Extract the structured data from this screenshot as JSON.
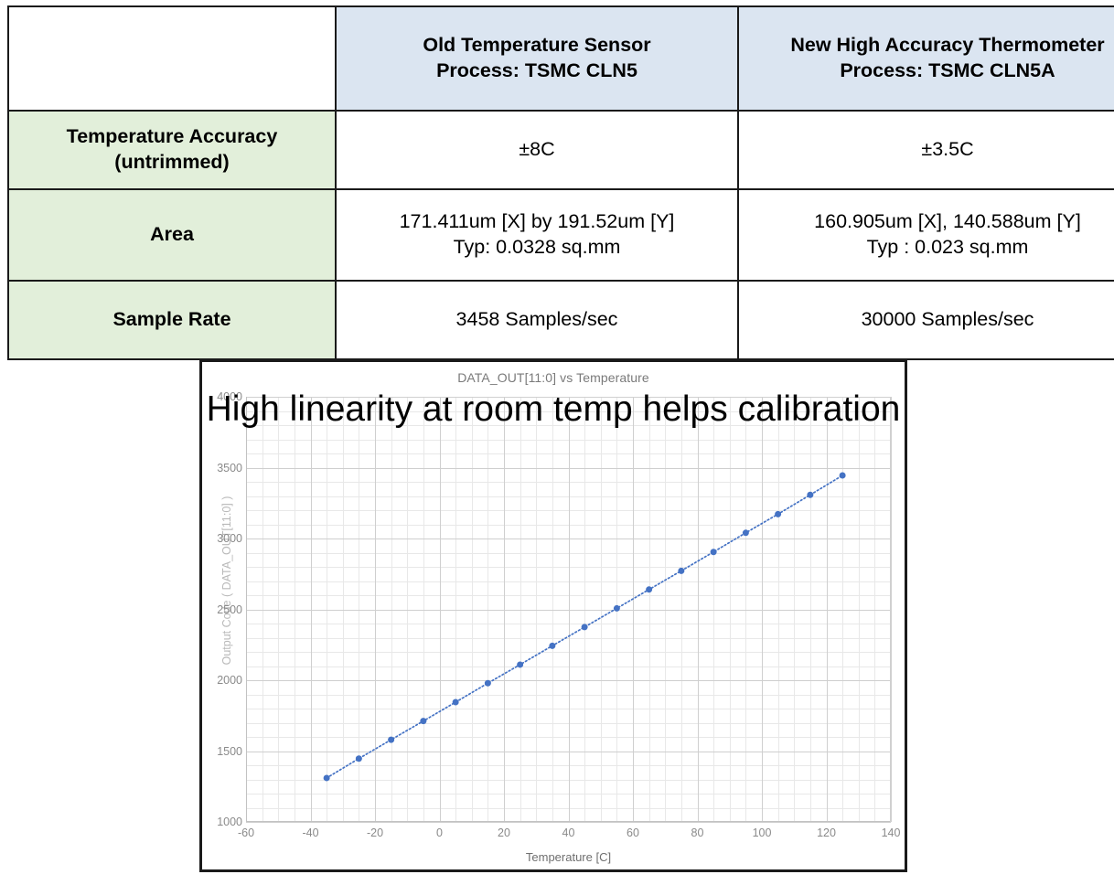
{
  "table": {
    "columns": [
      {
        "label": ""
      },
      {
        "title": "Old Temperature Sensor",
        "subtitle": "Process: TSMC CLN5"
      },
      {
        "title": "New High Accuracy Thermometer",
        "subtitle": "Process: TSMC CLN5A"
      }
    ],
    "rows": [
      {
        "label_line1": "Temperature Accuracy",
        "label_line2": "(untrimmed)",
        "old_line1": "±8C",
        "old_line2": "",
        "new_line1": "±3.5C",
        "new_line2": ""
      },
      {
        "label_line1": "Area",
        "label_line2": "",
        "old_line1": "171.411um [X] by 191.52um [Y]",
        "old_line2": "Typ: 0.0328 sq.mm",
        "new_line1": "160.905um [X], 140.588um [Y]",
        "new_line2": "Typ : 0.023 sq.mm"
      },
      {
        "label_line1": "Sample Rate",
        "label_line2": "",
        "old_line1": "3458  Samples/sec",
        "old_line2": "",
        "new_line1": "30000   Samples/sec",
        "new_line2": ""
      }
    ],
    "colors": {
      "header_fill": "#dbe5f1",
      "row_label_fill": "#e2efda",
      "border": "#1a1a1a"
    }
  },
  "chart_panel": {
    "annotation": "High linearity at room temp helps calibration"
  },
  "chart_data": {
    "type": "scatter",
    "title": "DATA_OUT[11:0] vs Temperature",
    "xlabel": "Temperature [C]",
    "ylabel": "Output Code ( DATA_OUT[11:0] )",
    "xlim": [
      -60,
      140
    ],
    "ylim": [
      1000,
      4000
    ],
    "xticks": [
      -60,
      -40,
      -20,
      0,
      20,
      40,
      60,
      80,
      100,
      120,
      140
    ],
    "yticks": [
      1000,
      1500,
      2000,
      2500,
      3000,
      3500,
      4000
    ],
    "x_minor_step": 5,
    "y_minor_step": 100,
    "grid": true,
    "legend": "none",
    "marker": "circle",
    "marker_size": 7,
    "line_style": "dotted",
    "color": "#4472c4",
    "x": [
      -35,
      -25,
      -15,
      -5,
      5,
      15,
      25,
      35,
      45,
      55,
      65,
      75,
      85,
      95,
      105,
      115,
      125
    ],
    "y": [
      1310,
      1447,
      1580,
      1712,
      1845,
      1979,
      2110,
      2243,
      2375,
      2507,
      2640,
      2772,
      2905,
      3040,
      3172,
      3308,
      3445
    ]
  }
}
